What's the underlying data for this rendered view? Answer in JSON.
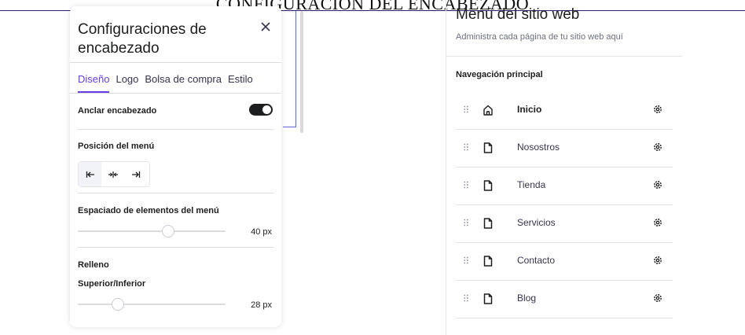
{
  "banner": {
    "title": "CONFIGURACIÓN DEL ENCABEZADO"
  },
  "header_settings": {
    "title": "Configuraciones de encabezado",
    "tabs": [
      {
        "label": "Diseño",
        "active": true
      },
      {
        "label": "Logo",
        "active": false
      },
      {
        "label": "Bolsa de compra",
        "active": false
      },
      {
        "label": "Estilo",
        "active": false
      }
    ],
    "sticky_header": {
      "label": "Anclar encabezado",
      "enabled": true
    },
    "menu_position": {
      "label": "Posición del menú",
      "options": [
        "left-align-icon",
        "center-align-icon",
        "right-align-icon"
      ],
      "selected": 0
    },
    "item_spacing": {
      "label": "Espaciado de elementos del menú",
      "value": "40 px",
      "fraction": 0.62
    },
    "padding": {
      "label": "Relleno",
      "vertical_label": "Superior/Inferior",
      "value": "28 px",
      "fraction": 0.25
    }
  },
  "site_menu": {
    "title": "Menú del sitio web",
    "subtitle": "Administra cada página de tu sitio web aquí",
    "nav_heading": "Navegación principal",
    "items": [
      {
        "label": "Inicio",
        "icon": "home-icon",
        "bold": true
      },
      {
        "label": "Nosostros",
        "icon": "page-icon",
        "bold": false
      },
      {
        "label": "Tienda",
        "icon": "page-icon",
        "bold": false
      },
      {
        "label": "Servicios",
        "icon": "page-icon",
        "bold": false
      },
      {
        "label": "Contacto",
        "icon": "page-icon",
        "bold": false
      },
      {
        "label": "Blog",
        "icon": "page-icon",
        "bold": false
      }
    ]
  },
  "colors": {
    "accent": "#673de6",
    "text": "#1d1e20",
    "divider": "#dadce0"
  }
}
